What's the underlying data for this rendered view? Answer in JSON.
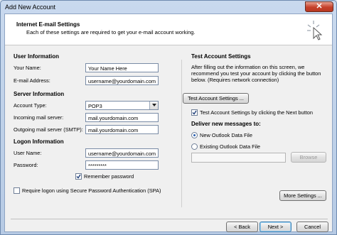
{
  "window": {
    "title": "Add New Account",
    "close_label": "✕"
  },
  "header": {
    "title": "Internet E-mail Settings",
    "subtitle": "Each of these settings are required to get your e-mail account working."
  },
  "user_info": {
    "heading": "User Information",
    "name_label": "Your Name:",
    "name_value": "Your Name Here",
    "email_label": "E-mail Address:",
    "email_value": "username@yourdomain.com"
  },
  "server_info": {
    "heading": "Server Information",
    "account_type_label": "Account Type:",
    "account_type_value": "POP3",
    "incoming_label": "Incoming mail server:",
    "incoming_value": "mail.yourdomain.com",
    "outgoing_label": "Outgoing mail server (SMTP):",
    "outgoing_value": "mail.yourdomain.com"
  },
  "logon_info": {
    "heading": "Logon Information",
    "username_label": "User Name:",
    "username_value": "username@yourdomain.com",
    "password_label": "Password:",
    "password_value": "*********",
    "remember_label": "Remember password",
    "remember_checked": true,
    "spa_label": "Require logon using Secure Password Authentication (SPA)",
    "spa_checked": false
  },
  "test": {
    "heading": "Test Account Settings",
    "description_1": "After filling out the information on this screen, we",
    "description_2": "recommend you test your account by clicking the button",
    "description_3": "below. (Requires network connection)",
    "button_label": "Test Account Settings ...",
    "auto_test_label": "Test Account Settings by clicking the Next button",
    "auto_test_checked": true
  },
  "deliver": {
    "heading": "Deliver new messages to:",
    "new_file_label": "New Outlook Data File",
    "existing_file_label": "Existing Outlook Data File",
    "browse_label": "Browse"
  },
  "more_settings_label": "More Settings ...",
  "footer": {
    "back_label": "< Back",
    "next_label": "Next >",
    "cancel_label": "Cancel"
  }
}
